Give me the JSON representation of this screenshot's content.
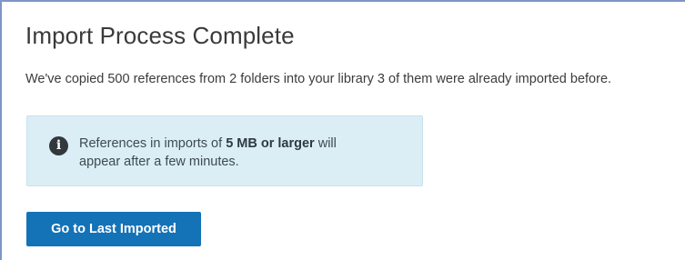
{
  "dialog": {
    "title": "Import Process Complete",
    "summary": "We've copied 500 references from 2 folders into your library 3 of them were already imported before."
  },
  "notice": {
    "icon": "info-icon",
    "icon_glyph": "i",
    "text_before": "References in imports of ",
    "text_bold": "5 MB or larger",
    "text_after": " will appear after a few minutes.",
    "background_color": "#dbeef5"
  },
  "actions": {
    "go_to_last_imported_label": "Go to Last Imported",
    "button_color": "#1472b7"
  }
}
